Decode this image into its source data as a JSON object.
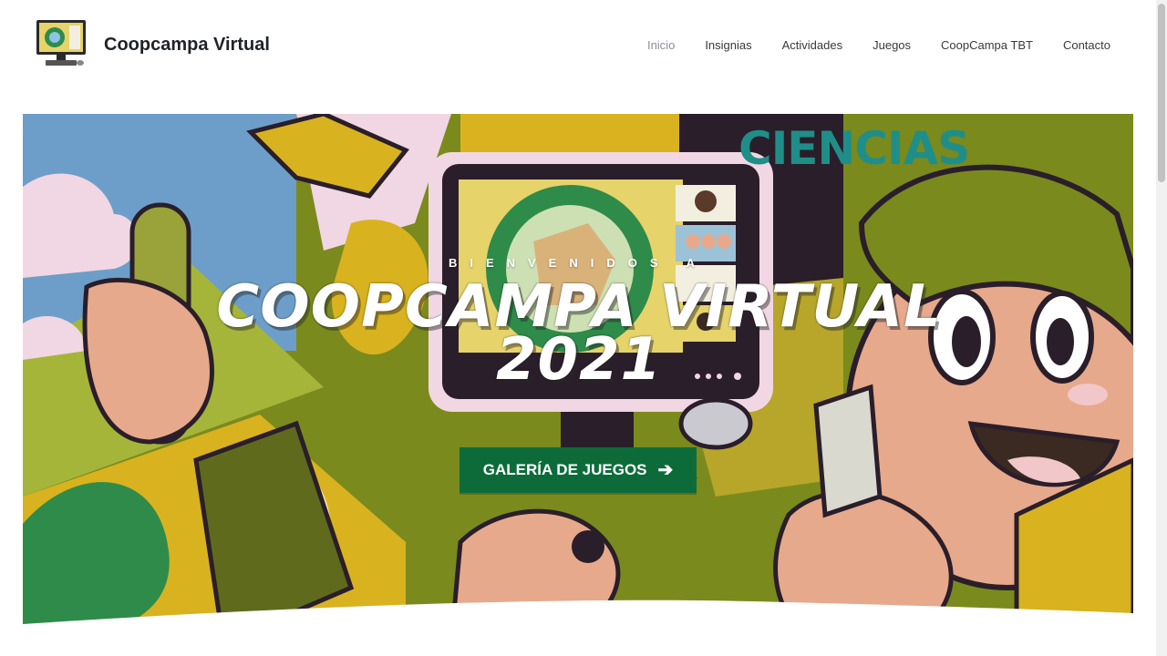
{
  "site": {
    "title": "Coopcampa Virtual"
  },
  "nav": {
    "items": [
      {
        "label": "Inicio",
        "active": true
      },
      {
        "label": "Insignias",
        "active": false
      },
      {
        "label": "Actividades",
        "active": false
      },
      {
        "label": "Juegos",
        "active": false
      },
      {
        "label": "CoopCampa TBT",
        "active": false
      },
      {
        "label": "Contacto",
        "active": false
      }
    ]
  },
  "hero": {
    "welcome": "BIENVENIDOS A",
    "title_line1": "COOPCAMPA VIRTUAL",
    "title_line2": "2021",
    "button_label": "GALERÍA DE JUEGOS",
    "button_icon": "arrow-right-icon",
    "art_text": "CIENCIAS",
    "monitor_text": "COOPCAMPA VIRTUAL 2021"
  },
  "colors": {
    "button": "#0d6b3a",
    "nav_active": "#8a8f96",
    "olive": "#7b8a1c",
    "yellow": "#d9b21f",
    "skin": "#e6a98c",
    "teal_text": "#1f8e88"
  }
}
